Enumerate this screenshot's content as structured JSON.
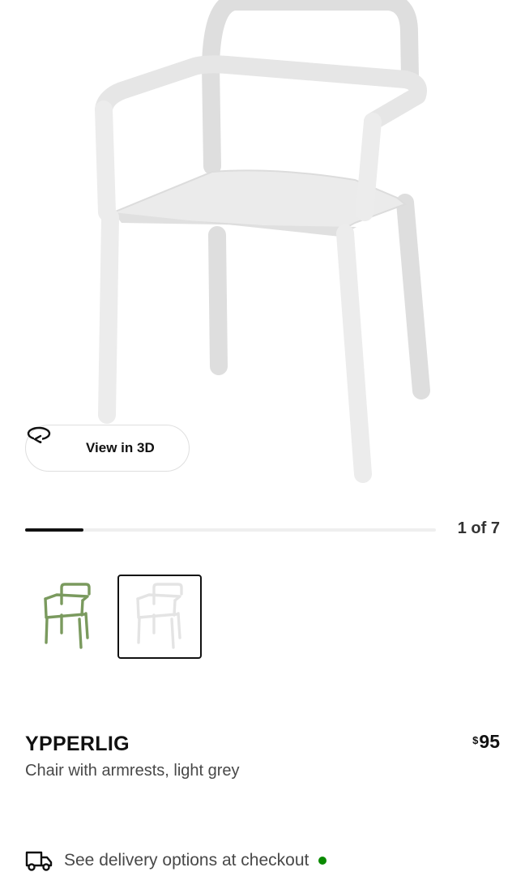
{
  "gallery": {
    "view_3d_label": "View in 3D",
    "counter": "1 of 7",
    "progress_fraction": 0.1429,
    "thumbnails": [
      {
        "name": "green",
        "color": "#7a9a5e",
        "selected": false
      },
      {
        "name": "light-grey",
        "color": "#e4e4e4",
        "selected": true
      }
    ]
  },
  "product": {
    "name": "YPPERLIG",
    "description": "Chair with armrests, light grey",
    "price_currency": "$",
    "price_amount": "95"
  },
  "delivery": {
    "text": "See delivery options at checkout",
    "status_color": "#0a8a00"
  },
  "icons": {
    "view_3d": "rotate-360-icon",
    "delivery": "truck-icon"
  }
}
